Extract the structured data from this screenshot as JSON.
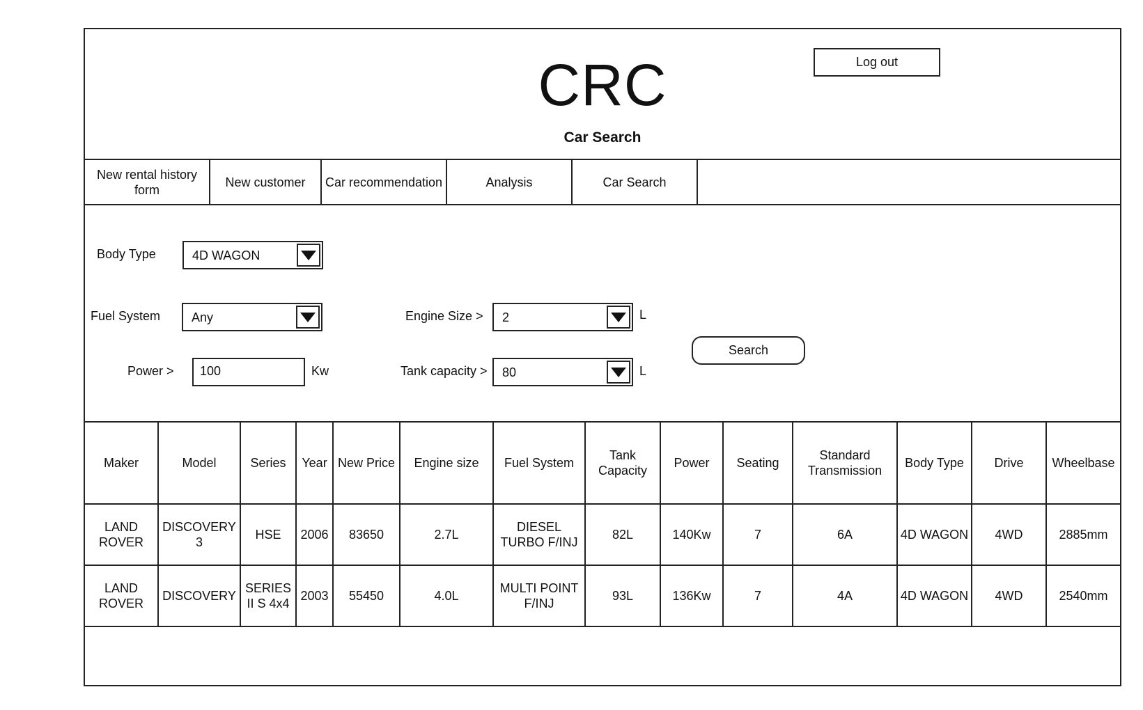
{
  "header": {
    "app_title": "CRC",
    "page_title": "Car Search",
    "logout_label": "Log out"
  },
  "tabs": [
    {
      "label": "New rental history form"
    },
    {
      "label": "New customer"
    },
    {
      "label": "Car recommendation"
    },
    {
      "label": "Analysis"
    },
    {
      "label": "Car Search"
    }
  ],
  "filters": {
    "body_type": {
      "label": "Body Type",
      "value": "4D WAGON"
    },
    "fuel_system": {
      "label": "Fuel System",
      "value": "Any"
    },
    "power": {
      "label": "Power >",
      "value": "100",
      "unit": "Kw"
    },
    "engine_size": {
      "label": "Engine Size >",
      "value": "2",
      "unit": "L"
    },
    "tank_capacity": {
      "label": "Tank capacity >",
      "value": "80",
      "unit": "L"
    },
    "search_label": "Search"
  },
  "table": {
    "headers": [
      "Maker",
      "Model",
      "Series",
      "Year",
      "New Price",
      "Engine size",
      "Fuel System",
      "Tank Capacity",
      "Power",
      "Seating",
      "Standard Transmission",
      "Body Type",
      "Drive",
      "Wheelbase"
    ],
    "rows": [
      [
        "LAND ROVER",
        "DISCOVERY 3",
        "HSE",
        "2006",
        "83650",
        "2.7L",
        "DIESEL TURBO F/INJ",
        "82L",
        "140Kw",
        "7",
        "6A",
        "4D WAGON",
        "4WD",
        "2885mm"
      ],
      [
        "LAND ROVER",
        "DISCOVERY",
        "SERIES II S 4x4",
        "2003",
        "55450",
        "4.0L",
        "MULTI POINT F/INJ",
        "93L",
        "136Kw",
        "7",
        "4A",
        "4D WAGON",
        "4WD",
        "2540mm"
      ]
    ]
  }
}
